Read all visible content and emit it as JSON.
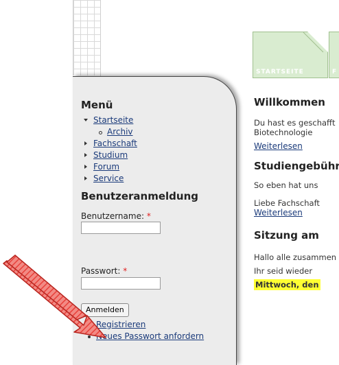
{
  "tabs": [
    {
      "label": "STARTSEITE"
    },
    {
      "label": "F"
    }
  ],
  "sidebar": {
    "menu_title": "Menü",
    "menu_items": [
      {
        "label": "Startseite",
        "expanded": true
      },
      {
        "label": "Archiv",
        "sub": true
      },
      {
        "label": "Fachschaft"
      },
      {
        "label": "Studium"
      },
      {
        "label": "Forum"
      },
      {
        "label": "Service"
      }
    ],
    "login_title": "Benutzeranmeldung",
    "username_label": "Benutzername:",
    "password_label": "Passwort:",
    "required_mark": "*",
    "login_button": "Anmelden",
    "links": [
      {
        "label": "Registrieren"
      },
      {
        "label": "Neues Passwort anfordern"
      }
    ]
  },
  "content": {
    "post1_title": "Willkommen",
    "post1_line1": "Du hast es geschafft",
    "post1_line2": "Biotechnologie",
    "post1_more": "Weiterlesen",
    "post2_title": "Studiengebühren",
    "post2_line1": "So eben hat uns",
    "post2_line2": "Liebe Fachschaft",
    "post2_more": "Weiterlesen",
    "post3_title": "Sitzung am",
    "post3_line1": "Hallo alle zusammen",
    "post3_line2": "Ihr seid wieder",
    "post3_highlight": "Mittwoch, den"
  },
  "colors": {
    "tab_bg": "#d9ecd0",
    "sidebar_bg": "#ececec",
    "link": "#1a3a7a",
    "highlight": "#ffff33",
    "arrow": "#e8403a"
  },
  "icons": [
    "tri-down-icon",
    "tri-right-icon",
    "circle-bullet-icon",
    "bullet-icon",
    "red-arrow-icon"
  ]
}
